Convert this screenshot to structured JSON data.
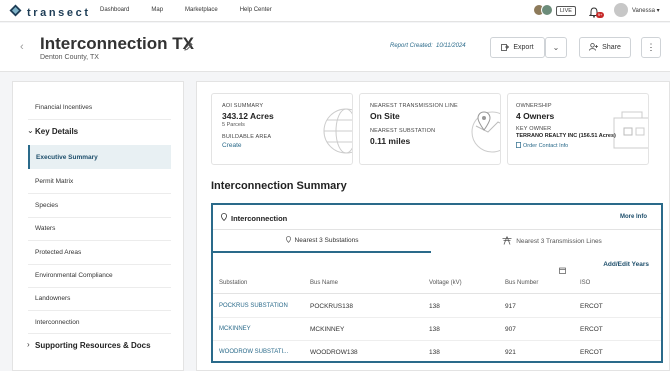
{
  "nav": {
    "logo_text": "transect",
    "links": [
      "Dashboard",
      "Map",
      "Marketplace",
      "Help Center"
    ],
    "live_label": "LIVE",
    "notif_badge": "9+",
    "user_name": "Vanessa"
  },
  "header": {
    "title": "Interconnection TX",
    "subtitle": "Denton County, TX",
    "report_created_label": "Report Created:",
    "report_created_date": "10/11/2024",
    "export_label": "Export",
    "share_label": "Share"
  },
  "sidebar": {
    "items": [
      {
        "label": "Financial Incentives"
      },
      {
        "label": "Key Details"
      },
      {
        "label": "Executive Summary"
      },
      {
        "label": "Permit Matrix"
      },
      {
        "label": "Species"
      },
      {
        "label": "Waters"
      },
      {
        "label": "Protected Areas"
      },
      {
        "label": "Environmental Compliance"
      },
      {
        "label": "Landowners"
      },
      {
        "label": "Interconnection"
      },
      {
        "label": "Supporting Resources & Docs"
      }
    ]
  },
  "cards": {
    "aoi": {
      "label": "AOI SUMMARY",
      "value": "343.12 Acres",
      "sub": "5 Parcels",
      "label2": "BUILDABLE AREA",
      "link": "Create"
    },
    "transmission": {
      "label": "NEAREST TRANSMISSION LINE",
      "value": "On Site",
      "label2": "NEAREST SUBSTATION",
      "value2": "0.11 miles"
    },
    "ownership": {
      "label": "OWNERSHIP",
      "value": "4 Owners",
      "label2": "KEY OWNER",
      "owner": "TERRANO REALTY INC (156.51 Acres)",
      "link": "Order Contact Info"
    }
  },
  "section_title": "Interconnection Summary",
  "interconnection": {
    "title": "Interconnection",
    "more_info": "More Info",
    "tabs": [
      "Nearest 3 Substations",
      "Nearest 3 Transmission Lines"
    ],
    "add_edit": "Add/Edit Years",
    "columns": [
      "Substation",
      "Bus Name",
      "Voltage (kV)",
      "Bus Number",
      "ISO"
    ],
    "rows": [
      [
        "POCKRUS SUBSTATION",
        "POCKRUS138",
        "138",
        "917",
        "ERCOT"
      ],
      [
        "MCKINNEY",
        "MCKINNEY",
        "138",
        "907",
        "ERCOT"
      ],
      [
        "WOODROW SUBSTATI...",
        "WOODROW138",
        "138",
        "921",
        "ERCOT"
      ]
    ]
  }
}
